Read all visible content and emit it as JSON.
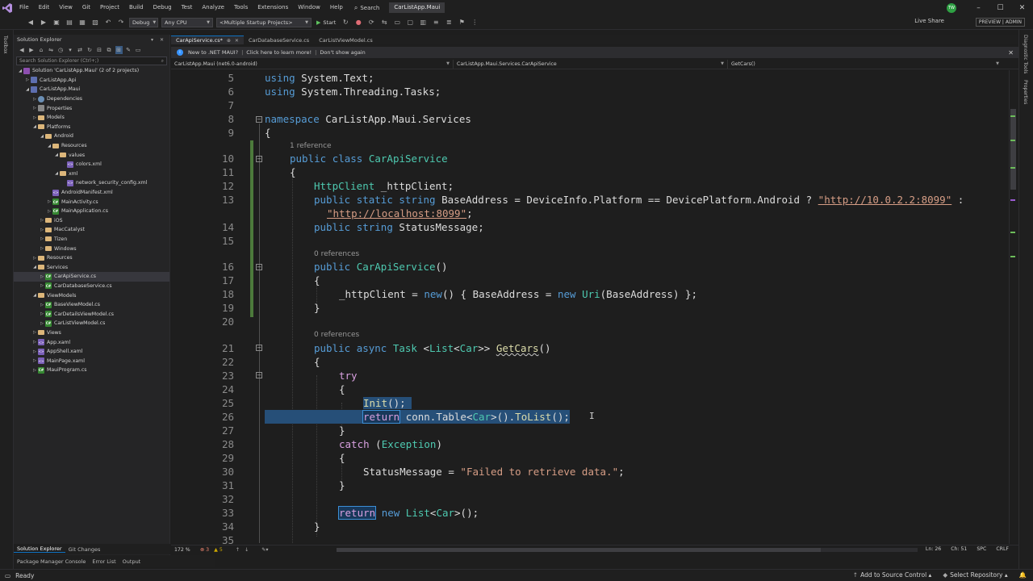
{
  "menu": {
    "items": [
      "File",
      "Edit",
      "View",
      "Git",
      "Project",
      "Build",
      "Debug",
      "Test",
      "Analyze",
      "Tools",
      "Extensions",
      "Window",
      "Help"
    ],
    "search_label": "Search",
    "app_title": "CarListApp.Maui",
    "avatar_initials": "TW",
    "minimize": "–",
    "maximize": "☐",
    "close": "✕"
  },
  "toolbar": {
    "configuration": "Debug",
    "platform": "Any CPU",
    "startup": "<Multiple Startup Projects>",
    "start_label": "Start",
    "live_share": "Live Share",
    "preview_badge": "PREVIEW | ADMIN"
  },
  "left_strip": {
    "label": "Toolbox"
  },
  "solution_explorer": {
    "title": "Solution Explorer",
    "search_placeholder": "Search Solution Explorer (Ctrl+;)",
    "tree": [
      {
        "label": "Solution 'CarListApp.Maui' (2 of 2 projects)",
        "depth": 0,
        "icon": "solution",
        "exp": "▲"
      },
      {
        "label": "CarListApp.Api",
        "depth": 1,
        "icon": "project",
        "exp": "▶"
      },
      {
        "label": "CarListApp.Maui",
        "depth": 1,
        "icon": "project",
        "exp": "▲"
      },
      {
        "label": "Dependencies",
        "depth": 2,
        "icon": "dependencies",
        "exp": "▶"
      },
      {
        "label": "Properties",
        "depth": 2,
        "icon": "properties",
        "exp": "▶"
      },
      {
        "label": "Models",
        "depth": 2,
        "icon": "folder",
        "exp": "▶"
      },
      {
        "label": "Platforms",
        "depth": 2,
        "icon": "folder",
        "exp": "▲"
      },
      {
        "label": "Android",
        "depth": 3,
        "icon": "folder",
        "exp": "▲"
      },
      {
        "label": "Resources",
        "depth": 4,
        "icon": "folder",
        "exp": "▲"
      },
      {
        "label": "values",
        "depth": 5,
        "icon": "folder",
        "exp": "▲"
      },
      {
        "label": "colors.xml",
        "depth": 6,
        "icon": "xml",
        "exp": ""
      },
      {
        "label": "xml",
        "depth": 5,
        "icon": "folder",
        "exp": "▲"
      },
      {
        "label": "network_security_config.xml",
        "depth": 6,
        "icon": "xml",
        "exp": ""
      },
      {
        "label": "AndroidManifest.xml",
        "depth": 4,
        "icon": "xml",
        "exp": ""
      },
      {
        "label": "MainActivity.cs",
        "depth": 4,
        "icon": "cs",
        "exp": "▶"
      },
      {
        "label": "MainApplication.cs",
        "depth": 4,
        "icon": "cs",
        "exp": "▶"
      },
      {
        "label": "iOS",
        "depth": 3,
        "icon": "folder",
        "exp": "▶"
      },
      {
        "label": "MacCatalyst",
        "depth": 3,
        "icon": "folder",
        "exp": "▶"
      },
      {
        "label": "Tizen",
        "depth": 3,
        "icon": "folder",
        "exp": "▶"
      },
      {
        "label": "Windows",
        "depth": 3,
        "icon": "folder",
        "exp": "▶"
      },
      {
        "label": "Resources",
        "depth": 2,
        "icon": "folder",
        "exp": "▶"
      },
      {
        "label": "Services",
        "depth": 2,
        "icon": "folder",
        "exp": "▲"
      },
      {
        "label": "CarApiService.cs",
        "depth": 3,
        "icon": "cs",
        "exp": "▶",
        "selected": true
      },
      {
        "label": "CarDatabaseService.cs",
        "depth": 3,
        "icon": "cs",
        "exp": "▶"
      },
      {
        "label": "ViewModels",
        "depth": 2,
        "icon": "folder",
        "exp": "▲"
      },
      {
        "label": "BaseViewModel.cs",
        "depth": 3,
        "icon": "cs",
        "exp": "▶"
      },
      {
        "label": "CarDetailsViewModel.cs",
        "depth": 3,
        "icon": "cs",
        "exp": "▶"
      },
      {
        "label": "CarListViewModel.cs",
        "depth": 3,
        "icon": "cs",
        "exp": "▶"
      },
      {
        "label": "Views",
        "depth": 2,
        "icon": "folder",
        "exp": "▶"
      },
      {
        "label": "App.xaml",
        "depth": 2,
        "icon": "xml",
        "exp": "▶"
      },
      {
        "label": "AppShell.xaml",
        "depth": 2,
        "icon": "xml",
        "exp": "▶"
      },
      {
        "label": "MainPage.xaml",
        "depth": 2,
        "icon": "xml",
        "exp": "▶"
      },
      {
        "label": "MauiProgram.cs",
        "depth": 2,
        "icon": "cs",
        "exp": "▶"
      }
    ],
    "bottom_tabs": [
      "Solution Explorer",
      "Git Changes"
    ]
  },
  "lower_panel_tabs": [
    "Package Manager Console",
    "Error List",
    "Output"
  ],
  "doc_tabs": [
    {
      "label": "CarApiService.cs*",
      "active": true
    },
    {
      "label": "CarDatabaseService.cs",
      "active": false
    },
    {
      "label": "CarListViewModel.cs",
      "active": false
    }
  ],
  "info_bar": {
    "text": "New to .NET MAUI?",
    "link1": "Click here to learn more!",
    "link2": "Don't show again"
  },
  "nav_bar": {
    "project": "CarListApp.Maui (net6.0-android)",
    "type": "CarListApp.Maui.Services.CarApiService",
    "member": "GetCars()"
  },
  "editor": {
    "line_numbers": [
      "5",
      "6",
      "7",
      "8",
      "9",
      "10",
      "11",
      "12",
      "13",
      "14",
      "15",
      "16",
      "17",
      "18",
      "19",
      "20",
      "21",
      "22",
      "23",
      "24",
      "25",
      "26",
      "27",
      "28",
      "29",
      "30",
      "31",
      "32",
      "33",
      "34",
      "35"
    ],
    "codelens": {
      "class_refs": "1 reference",
      "ctor_refs": "0 references",
      "getcars_refs": "0 references"
    },
    "tokens": {
      "using": "using",
      "ns_text": "System.Text;",
      "ns_tasks": "System.Threading.Tasks;",
      "namespace_kw": "namespace",
      "namespace_name": "CarListApp.Maui.Services",
      "lbrace": "{",
      "rbrace": "}",
      "public": "public",
      "class_kw": "class",
      "class_name": "CarApiService",
      "httpclient_type": "HttpClient",
      "httpclient_field": "_httpClient;",
      "static": "static",
      "string": "string",
      "base_address_decl": "BaseAddress = DeviceInfo.Platform == DevicePlatform.Android ?",
      "url1": "\"http://10.0.2.2:8099\"",
      "colon": ":",
      "url2": "\"http://localhost:8099\"",
      "semicolon": ";",
      "status_message_decl": "StatusMessage;",
      "ctor_name": "CarApiService",
      "parens": "()",
      "httpclient_assign": "_httpClient =",
      "new": "new",
      "ctor_init_mid": "() { BaseAddress =",
      "uri_type": "Uri",
      "ctor_init_end": "(BaseAddress) };",
      "async": "async",
      "task_type": "Task",
      "lt": "<",
      "list_type": "List",
      "car_type": "Car",
      "gtgt": ">>",
      "getcars": "GetCars",
      "try": "try",
      "init_call": "Init",
      "init_end": "();",
      "return": "return",
      "conn_table": "conn.Table",
      "gt_parens": ">().",
      "tolist": "ToList",
      "catch": "catch",
      "exception_open": "(",
      "exception_type": "Exception",
      "exception_close": ")",
      "status_assign": "StatusMessage =",
      "failed_str": "\"Failed to retrieve data.\"",
      "gt_paren_end": ">();"
    }
  },
  "editor_bottom": {
    "zoom": "172 %",
    "errors": "⊗ 3",
    "warnings": "▲ 5",
    "line": "Ln: 26",
    "col": "Ch: 51",
    "spc": "SPC",
    "crlf": "CRLF"
  },
  "right_strip": {
    "labels": [
      "Diagnostic Tools",
      "Properties"
    ]
  },
  "statusbar": {
    "ready": "Ready",
    "source_control": "Add to Source Control",
    "select_repository": "Select Repository"
  },
  "colors": {
    "keyword": "#569cd6",
    "type": "#4ec9b0",
    "string": "#d69d85",
    "method": "#dcdcaa",
    "control": "#d8a0df",
    "selection": "#264f78",
    "accent": "#0e70c0"
  }
}
